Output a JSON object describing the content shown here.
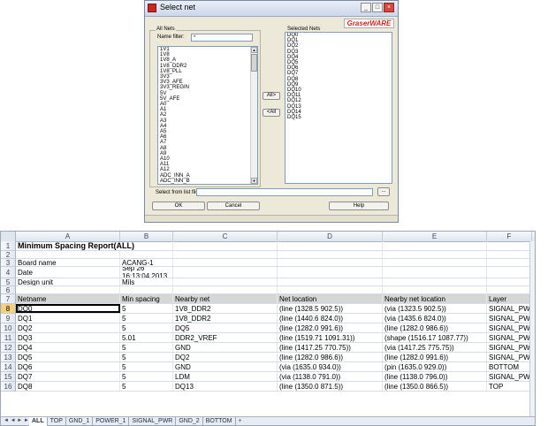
{
  "dialog": {
    "title": "Select net",
    "logo": "GraserWARE",
    "all_nets_label": "All Nets",
    "name_filter_label": "Name filter:",
    "name_filter_value": "*",
    "all_nets": [
      "1V1",
      "1V8",
      "1V8_A",
      "1V8_DDR2",
      "1V8_PLL",
      "3V3",
      "3V3_AFE",
      "3V3_REGIN",
      "5V",
      "5V_AFE",
      "A0",
      "A1",
      "A2",
      "A3",
      "A4",
      "A5",
      "A6",
      "A7",
      "A8",
      "A9",
      "A10",
      "A11",
      "A12",
      "ADC_INN_A",
      "ADC_INN_B",
      "ADC_INP_A"
    ],
    "selected_nets_label": "Selected Nets",
    "selected_nets": [
      "DQ0",
      "DQ1",
      "DQ2",
      "DQ3",
      "DQ4",
      "DQ5",
      "DQ6",
      "DQ7",
      "DQ8",
      "DQ9",
      "DQ10",
      "DQ11",
      "DQ12",
      "DQ13",
      "DQ14",
      "DQ15"
    ],
    "all_right_button": "All>",
    "all_left_button": "<All",
    "select_from_list_label": "Select from list file:",
    "select_from_list_value": "",
    "browse_button": "...",
    "ok_button": "OK",
    "cancel_button": "Cancel",
    "help_button": "Help",
    "window_buttons": {
      "minimize": "_",
      "maximize": "□",
      "close": "×"
    }
  },
  "sheet": {
    "columns": [
      "A",
      "B",
      "C",
      "D",
      "E",
      "F"
    ],
    "rows": [
      {
        "n": "1",
        "cells": [
          "Minimum Spacing Report(ALL)",
          "",
          "",
          "",
          "",
          ""
        ]
      },
      {
        "n": "2",
        "cells": [
          "",
          "",
          "",
          "",
          "",
          ""
        ]
      },
      {
        "n": "3",
        "cells": [
          "Board name",
          "ACANG-1",
          "",
          "",
          "",
          ""
        ]
      },
      {
        "n": "4",
        "cells": [
          "Date",
          "Sep 26 16:13:04 2013",
          "",
          "",
          "",
          ""
        ]
      },
      {
        "n": "5",
        "cells": [
          "Design unit",
          "Mils",
          "",
          "",
          "",
          ""
        ]
      },
      {
        "n": "6",
        "cells": [
          "",
          "",
          "",
          "",
          "",
          ""
        ]
      },
      {
        "n": "7",
        "cells": [
          "Netname",
          "Min spacing",
          "Nearby net",
          "Net location",
          "Nearby net location",
          "Layer"
        ]
      },
      {
        "n": "8",
        "cells": [
          "DQ0",
          "5",
          "1V8_DDR2",
          "(line (1328.5 902.5))",
          "(via (1323.5 902.5))",
          "SIGNAL_PWR"
        ]
      },
      {
        "n": "9",
        "cells": [
          "DQ1",
          "5",
          "1V8_DDR2",
          "(line (1440.6 824.0))",
          "(via (1435.6 824.0))",
          "SIGNAL_PWR"
        ]
      },
      {
        "n": "10",
        "cells": [
          "DQ2",
          "5",
          "DQ5",
          "(line (1282.0 991.6))",
          "(line (1282.0 986.6))",
          "SIGNAL_PWR"
        ]
      },
      {
        "n": "11",
        "cells": [
          "DQ3",
          "5.01",
          "DDR2_VREF",
          "(line (1519.71 1091.31))",
          "(shape (1516.17 1087.77))",
          "SIGNAL_PWR"
        ]
      },
      {
        "n": "12",
        "cells": [
          "DQ4",
          "5",
          "GND",
          "(line (1417.25 770.75))",
          "(via (1417.25 775.75))",
          "SIGNAL_PWR"
        ]
      },
      {
        "n": "13",
        "cells": [
          "DQ5",
          "5",
          "DQ2",
          "(line (1282.0 986.6))",
          "(line (1282.0 991.6))",
          "SIGNAL_PWR"
        ]
      },
      {
        "n": "14",
        "cells": [
          "DQ6",
          "5",
          "GND",
          "(via (1635.0 934.0))",
          "(pin (1635.0 929.0))",
          "BOTTOM"
        ]
      },
      {
        "n": "15",
        "cells": [
          "DQ7",
          "5",
          "LDM",
          "(via (1138.0 791.0))",
          "(line (1138.0 796.0))",
          "SIGNAL_PWR"
        ]
      },
      {
        "n": "16",
        "cells": [
          "DQ8",
          "5",
          "DQ13",
          "(line (1350.0 871.5))",
          "(line (1350.0 866.5))",
          "TOP"
        ]
      }
    ],
    "tabs": [
      "ALL",
      "TOP",
      "GND_1",
      "POWER_1",
      "SIGNAL_PWR",
      "GND_2",
      "BOTTOM"
    ],
    "tab_nav": "◄ ◄ ► ►",
    "tab_add": "+"
  },
  "colors": {
    "dialog_bg": "#ece9d8",
    "header_row_bg": "#d6d6d6",
    "selected_row_header": "#f8cf7b",
    "logo_red": "#c8281e"
  }
}
